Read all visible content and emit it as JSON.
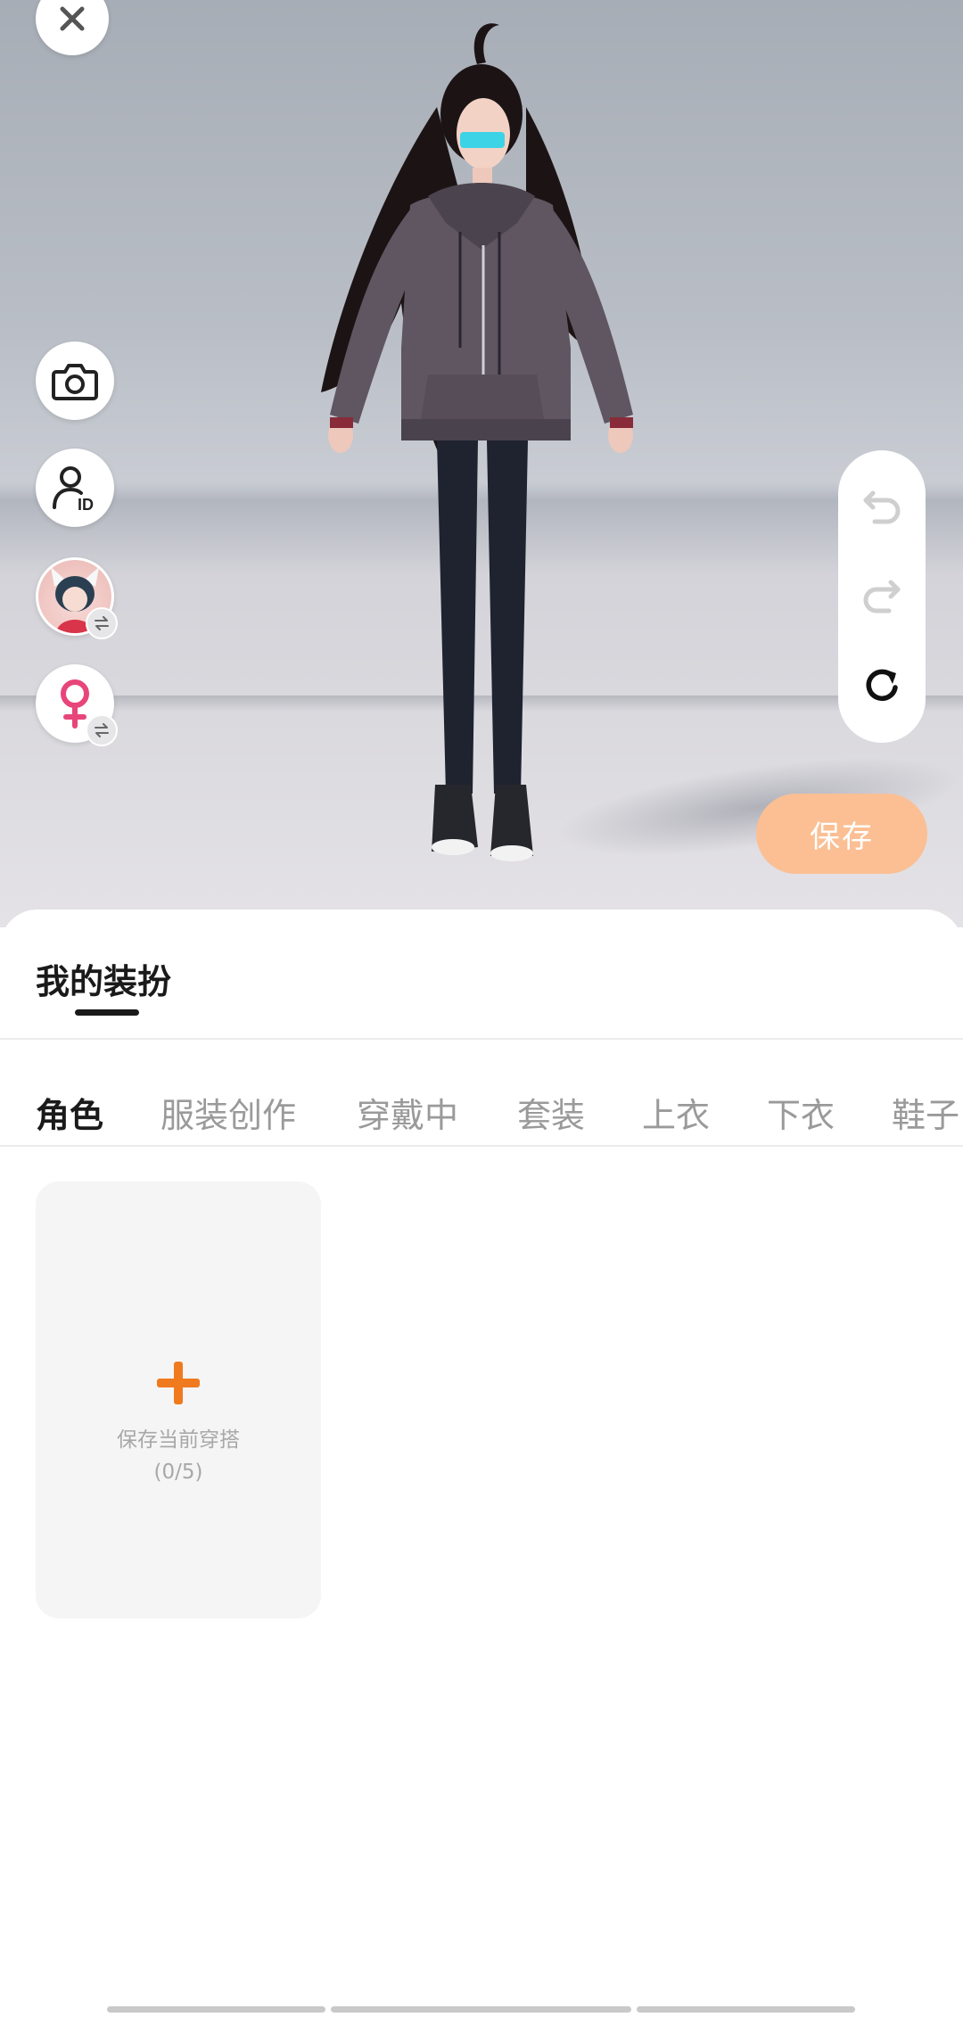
{
  "actions": {
    "save_label": "保存"
  },
  "sheet": {
    "title": "我的装扮",
    "tabs": [
      "角色",
      "服装创作",
      "穿戴中",
      "套装",
      "上衣",
      "下衣",
      "鞋子"
    ],
    "active_tab": "角色",
    "save_outfit_card": {
      "label": "保存当前穿搭",
      "count": "(0/5)"
    }
  },
  "colors": {
    "accent_orange": "#f07a1e",
    "save_button": "#fbbf93",
    "female_icon": "#e8457a"
  },
  "icons": [
    "close-icon",
    "camera-icon",
    "user-id-icon",
    "avatar-switch-icon",
    "gender-female-icon",
    "swap-icon",
    "undo-icon",
    "redo-icon",
    "reset-icon",
    "plus-icon"
  ]
}
